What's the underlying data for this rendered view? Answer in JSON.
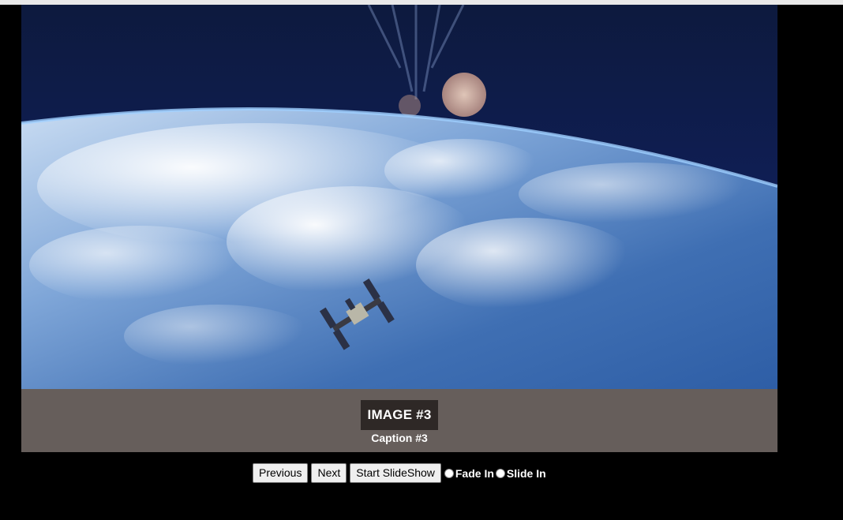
{
  "slideshow": {
    "image": {
      "icon": "earth-orbit-space-station-photo"
    },
    "caption_title": "IMAGE #3",
    "caption_text": "Caption #3"
  },
  "controls": {
    "previous_label": "Previous",
    "next_label": "Next",
    "start_label": "Start SlideShow",
    "fade_label": "Fade In",
    "slide_label": "Slide In"
  },
  "colors": {
    "background": "#000000",
    "caption_band": "#665e5b",
    "caption_title_bg": "#2e2826"
  }
}
